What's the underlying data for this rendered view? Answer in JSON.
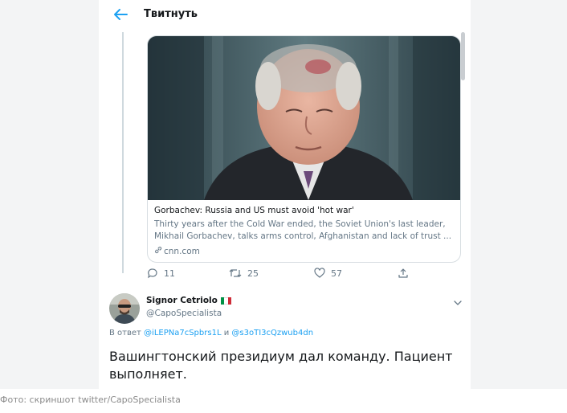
{
  "header": {
    "title": "Твитнуть",
    "back_icon": "arrow-left-icon"
  },
  "colors": {
    "accent": "#1da1f2",
    "text": "#14171a",
    "muted": "#657786",
    "flag": [
      "#009246",
      "#ffffff",
      "#ce2b37"
    ]
  },
  "card": {
    "image": "photo-of-elderly-man-in-suit",
    "title": "Gorbachev: Russia and US must avoid 'hot war'",
    "description_lines": [
      "Thirty years after the Cold War ended, the Soviet Union's last leader,",
      "Mikhail Gorbachev, talks arms control, Afghanistan and lack of trust ..."
    ],
    "domain": "cnn.com",
    "domain_icon": "link-icon"
  },
  "actions": {
    "reply_count": "11",
    "retweet_count": "25",
    "like_count": "57"
  },
  "tweet": {
    "name": "Signor Cetriolo",
    "handle": "@CapoSpecialista",
    "flag": "flag-italy-icon",
    "reply_prefix": "В ответ",
    "reply_user1": "@iLEPNa7cSpbrs1L",
    "reply_and": "и",
    "reply_user2": "@s3oTI3cQzwub4dn",
    "text_line1": "Вашингтонский президиум дал команду. Пациент",
    "text_line2": "выполняет."
  },
  "caption": "Фото: скриншот twitter/CapoSpecialista"
}
